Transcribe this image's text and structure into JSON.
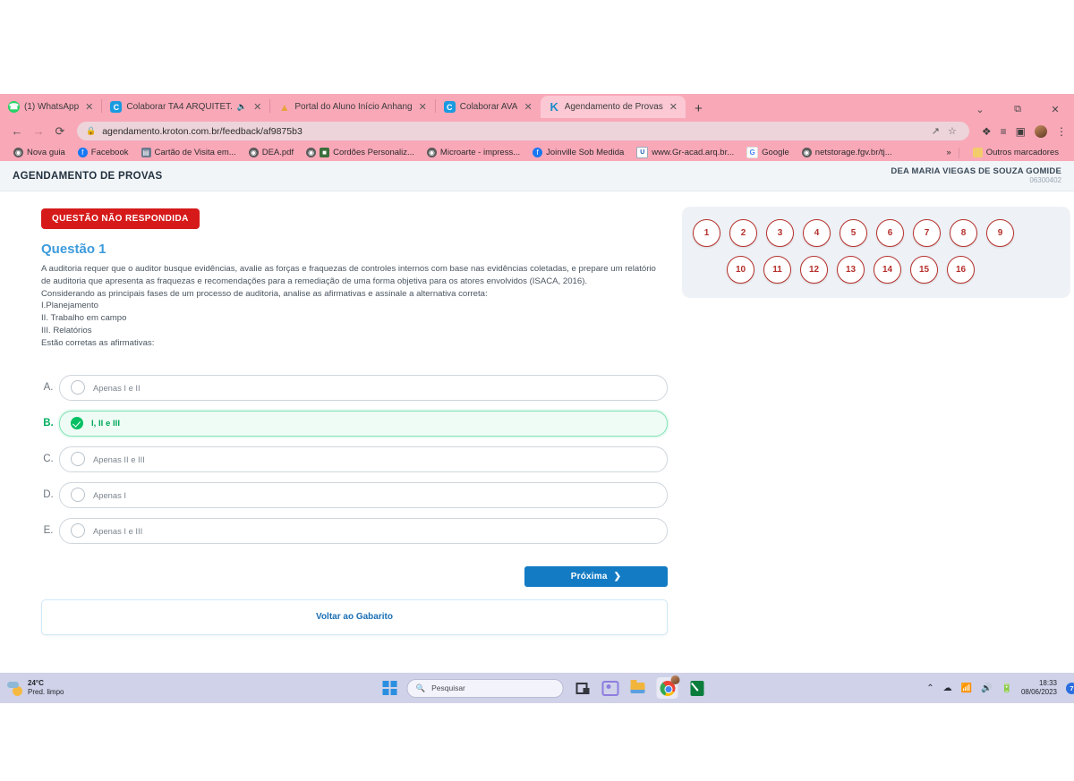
{
  "browser": {
    "tabs": [
      {
        "title": "(1) WhatsApp",
        "icon": "whatsapp-icon",
        "active": false,
        "muted": false
      },
      {
        "title": "Colaborar  TA4  ARQUITET.",
        "icon": "colaborar-icon",
        "active": false,
        "muted": true
      },
      {
        "title": "Portal do Aluno  Início  Anhang",
        "icon": "portal-aluno-icon",
        "active": false,
        "muted": false
      },
      {
        "title": "Colaborar  AVA",
        "icon": "colaborar-icon",
        "active": false,
        "muted": false
      },
      {
        "title": "Agendamento de Provas",
        "icon": "agendamento-icon",
        "active": true,
        "muted": false
      }
    ],
    "new_tab_label": "+",
    "window_controls": {
      "minimize": "⌄",
      "maximize": "⧉",
      "close": "✕"
    },
    "nav": {
      "back": "←",
      "forward": "→",
      "reload": "⟳"
    },
    "omnibox": {
      "url": "agendamento.kroton.com.br/feedback/af9875b3",
      "lock": "🔒",
      "share_icon": "share-icon",
      "bookmark_icon": "star-icon"
    },
    "toolbar_icons": [
      "extensions-icon",
      "reading-list-icon",
      "side-panel-icon",
      "profile-avatar",
      "chrome-menu-icon"
    ],
    "bookmarks": [
      {
        "label": "Nova guia",
        "icon": "globe-icon"
      },
      {
        "label": "Facebook",
        "icon": "facebook-icon"
      },
      {
        "label": "Cartão de Visita em...",
        "icon": "document-icon"
      },
      {
        "label": "DEA.pdf",
        "icon": "globe-icon"
      },
      {
        "label": "Cordões Personaliz...",
        "icon": "cordoes-icon"
      },
      {
        "label": "Microarte - impress...",
        "icon": "globe-icon"
      },
      {
        "label": "Joinville Sob Medida",
        "icon": "facebook-icon"
      },
      {
        "label": "www.Gr-acad.arq.br...",
        "icon": "u-icon"
      },
      {
        "label": "Google",
        "icon": "google-icon"
      },
      {
        "label": "netstorage.fgv.br/tj...",
        "icon": "globe-icon"
      }
    ],
    "bookmarks_overflow": "»",
    "other_bookmarks": {
      "label": "Outros marcadores",
      "icon": "folder-icon"
    }
  },
  "page": {
    "header": {
      "app_title": "AGENDAMENTO DE PROVAS",
      "user_name": "DEA MARIA VIEGAS DE SOUZA GOMIDE",
      "user_id": "06300402"
    },
    "status_badge": "QUESTÃO NÃO RESPONDIDA",
    "question": {
      "title": "Questão 1",
      "paragraphs": [
        "A auditoria requer que o auditor busque evidências, avalie as forças e fraquezas de controles internos com base nas evidências coletadas, e prepare um relatório de auditoria que apresenta as fraquezas e recomendações para a remediação de uma forma objetiva para os atores envolvidos (ISACA, 2016).",
        "Considerando as principais fases de um processo de auditoria, analise as afirmativas e assinale a alternativa correta:",
        "I.Planejamento",
        "II. Trabalho em campo",
        "III. Relatórios",
        "Estão corretas as afirmativas:"
      ]
    },
    "options": [
      {
        "letter": "A.",
        "label": "Apenas I e II",
        "selected": false
      },
      {
        "letter": "B.",
        "label": "I, II e III",
        "selected": true
      },
      {
        "letter": "C.",
        "label": "Apenas II e III",
        "selected": false
      },
      {
        "letter": "D.",
        "label": "Apenas I",
        "selected": false
      },
      {
        "letter": "E.",
        "label": "Apenas I e III",
        "selected": false
      }
    ],
    "buttons": {
      "next": "Próxima",
      "next_chevron": "›",
      "back_to_answer_key": "Voltar ao Gabarito"
    },
    "navigator": {
      "row1": [
        "1",
        "2",
        "3",
        "4",
        "5",
        "6",
        "7",
        "8",
        "9"
      ],
      "row2": [
        "10",
        "11",
        "12",
        "13",
        "14",
        "15",
        "16"
      ]
    },
    "colors": {
      "accent_blue": "#3d9bdc",
      "danger_red": "#d61a1a",
      "success_green": "#00c063",
      "button_blue": "#127bc4",
      "navigator_red": "#b5302c"
    }
  },
  "taskbar": {
    "weather": {
      "temp": "24°C",
      "desc": "Pred. limpo",
      "icon": "moon-cloud-icon"
    },
    "start_icon": "windows-start-icon",
    "search": {
      "placeholder": "Pesquisar",
      "icon": "search-icon"
    },
    "apps": [
      "task-view-icon",
      "chat-icon",
      "file-explorer-icon",
      "chrome-icon",
      "money-app-icon"
    ],
    "tray": {
      "overflow": "⌃",
      "icons": [
        "onedrive-icon",
        "wifi-icon",
        "volume-icon",
        "battery-icon"
      ],
      "time": "18:33",
      "date": "08/06/2023",
      "notification_count": "7"
    }
  }
}
